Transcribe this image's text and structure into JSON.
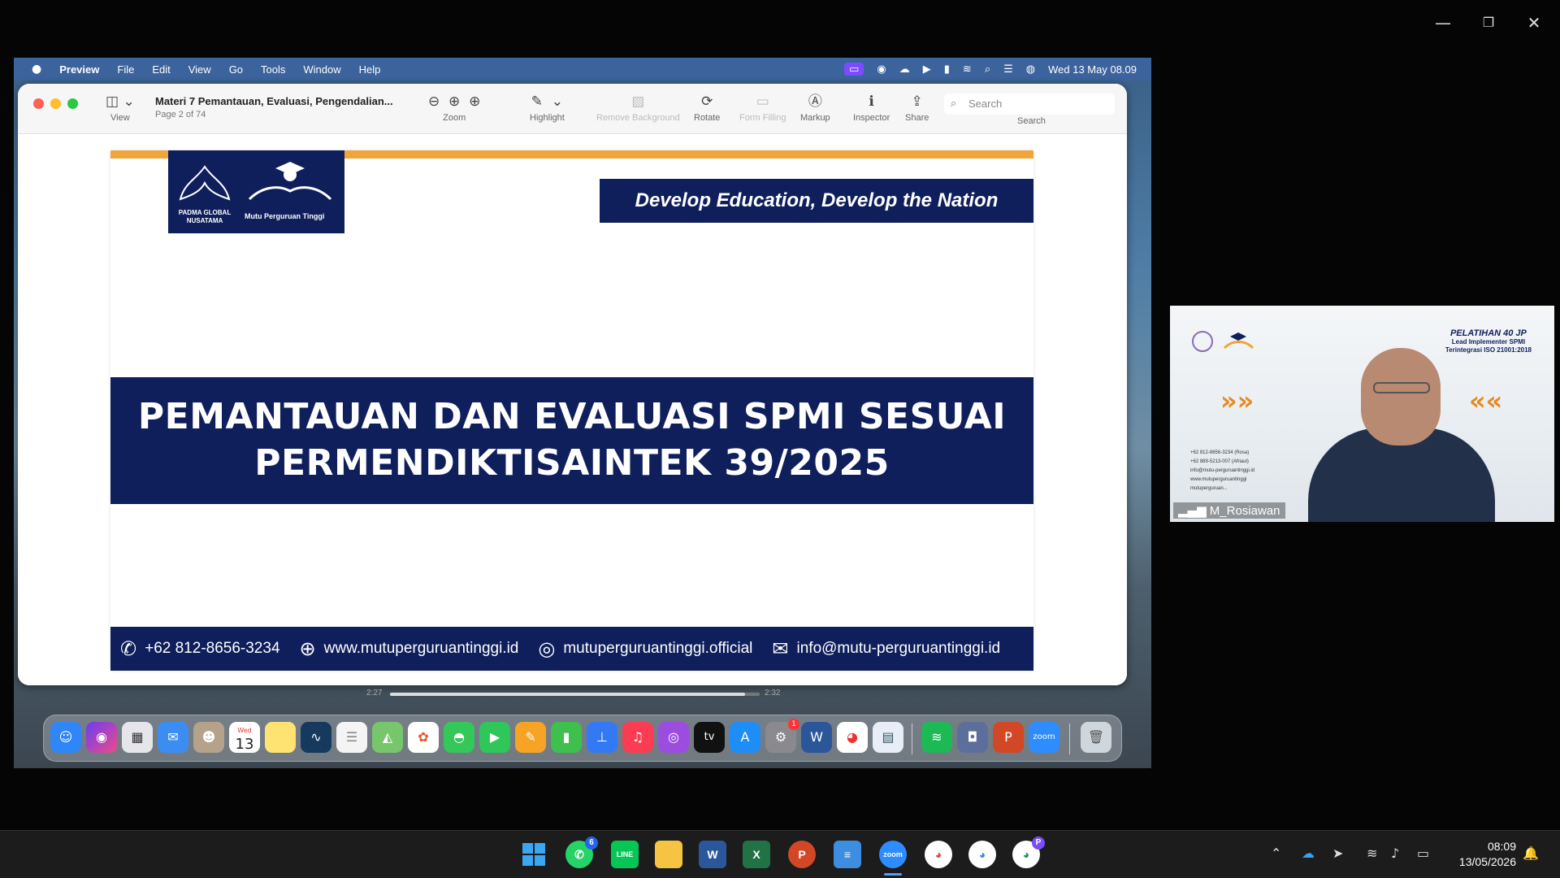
{
  "window_controls": {
    "minimize": "—",
    "restore": "❐",
    "close": "✕"
  },
  "mac_menubar": {
    "app_name": "Preview",
    "menus": [
      "File",
      "Edit",
      "View",
      "Go",
      "Tools",
      "Window",
      "Help"
    ],
    "datetime": "Wed 13 May  08.09"
  },
  "preview": {
    "doc_title": "Materi 7 Pemantauan, Evaluasi, Pengendalian...",
    "page_info": "Page 2 of 74",
    "toolbar": {
      "view": "View",
      "zoom": "Zoom",
      "highlight": "Highlight",
      "remove_background": "Remove Background",
      "rotate": "Rotate",
      "form_filling": "Form Filling",
      "markup": "Markup",
      "inspector": "Inspector",
      "share": "Share",
      "search_placeholder": "Search",
      "search_label": "Search"
    }
  },
  "slide": {
    "logo_text_1": "PADMA GLOBAL NUSATAMA",
    "logo_text_2": "Mutu Perguruan Tinggi",
    "slogan": "Develop Education, Develop the Nation",
    "title_line1": "PEMANTAUAN DAN EVALUASI SPMI SESUAI",
    "title_line2": "PERMENDIKTISAINTEK 39/2025",
    "footer": {
      "phone": "+62 812-8656-3234",
      "website": "www.mutuperguruantinggi.id",
      "instagram": "mutuperguruantinggi.official",
      "email": "info@mutu-perguruantinggi.id"
    }
  },
  "playback": {
    "elapsed": "2:27",
    "total": "2:32",
    "progress": 0.96
  },
  "video": {
    "name": "M_Rosiawan",
    "title_a": "PELATIHAN 40 JP",
    "title_b": "Lead Implementer SPMI",
    "title_c": "Terintegrasi ISO 21001:2018",
    "contact_1": "+62 812-8656-3234 (Rosa)",
    "contact_2": "+62 889-5213-007 (Afriaul)",
    "contact_3": "info@mutu-perguruantinggi.id",
    "contact_4": "www.mutuperguruantinggi",
    "contact_5": "mutuperguruan..."
  },
  "dock": {
    "calendar_month": "Wed",
    "calendar_day": "13",
    "settings_badge": "1",
    "appletv": "tv",
    "zoom": "zoom"
  },
  "taskbar": {
    "whatsapp_badge": "6",
    "line": "LINE",
    "zoom": "zoom",
    "profile_badge": "P",
    "clock_time": "08:09",
    "clock_date": "13/05/2026"
  }
}
